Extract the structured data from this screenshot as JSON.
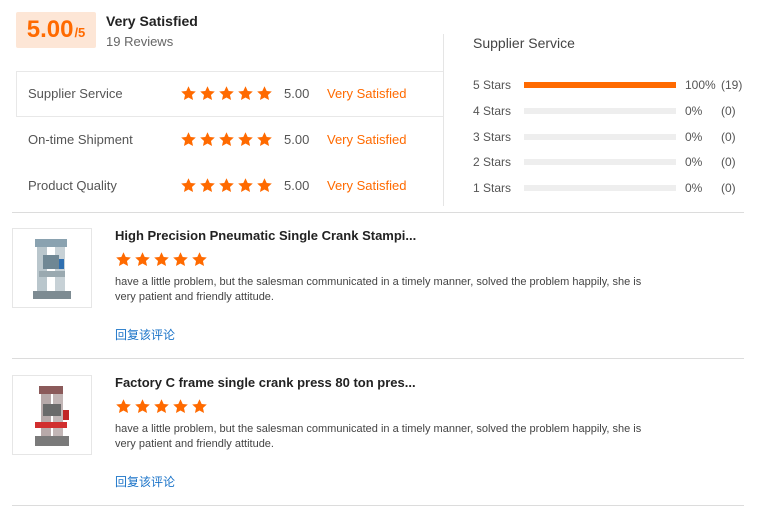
{
  "summary": {
    "score": "5.00",
    "score_denominator": "/5",
    "overall_label": "Very Satisfied",
    "reviews_count": "19 Reviews"
  },
  "ratings": [
    {
      "label": "Supplier Service",
      "score": "5.00",
      "verdict": "Very Satisfied",
      "stars": 5
    },
    {
      "label": "On-time Shipment",
      "score": "5.00",
      "verdict": "Very Satisfied",
      "stars": 5
    },
    {
      "label": "Product Quality",
      "score": "5.00",
      "verdict": "Very Satisfied",
      "stars": 5
    }
  ],
  "distribution": {
    "title": "Supplier Service",
    "rows": [
      {
        "label": "5 Stars",
        "percent": "100%",
        "count": "(19)",
        "fraction": 1.0
      },
      {
        "label": "4 Stars",
        "percent": "0%",
        "count": "(0)",
        "fraction": 0
      },
      {
        "label": "3 Stars",
        "percent": "0%",
        "count": "(0)",
        "fraction": 0
      },
      {
        "label": "2 Stars",
        "percent": "0%",
        "count": "(0)",
        "fraction": 0
      },
      {
        "label": "1 Stars",
        "percent": "0%",
        "count": "(0)",
        "fraction": 0
      }
    ]
  },
  "reviews": [
    {
      "product_title": "High Precision Pneumatic Single Crank Stampi...",
      "stars": 5,
      "text": "have a little problem, but the salesman communicated in a timely manner, solved the problem happily, she is very patient and friendly attitude.",
      "reply_label": "回复该评论"
    },
    {
      "product_title": "Factory C frame single crank press 80 ton pres...",
      "stars": 5,
      "text": "have a little problem, but the salesman communicated in a timely manner, solved the problem happily, she is very patient and friendly attitude.",
      "reply_label": "回复该评论"
    }
  ],
  "colors": {
    "accent": "#ff6a00",
    "link": "#1a73c8",
    "score_bg": "#fde6d6"
  },
  "icons": {
    "star": "star-icon"
  }
}
